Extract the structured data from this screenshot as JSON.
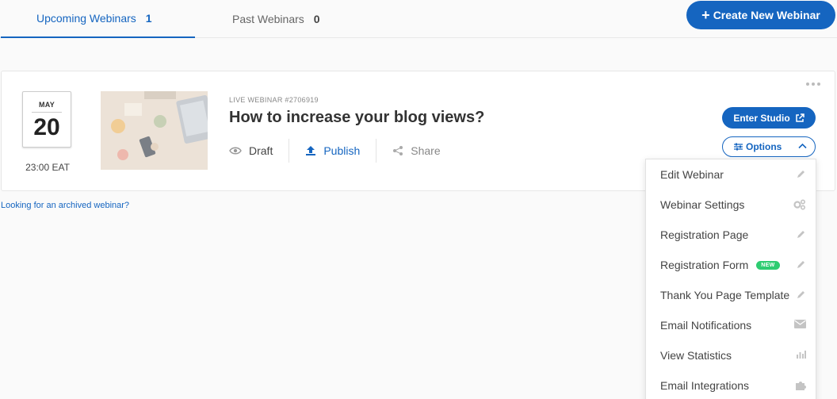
{
  "tabs": [
    {
      "label": "Upcoming Webinars",
      "count": "1"
    },
    {
      "label": "Past Webinars",
      "count": "0"
    }
  ],
  "header": {
    "create_label": "Create New Webinar",
    "create_icon": "plus-icon"
  },
  "webinar": {
    "month": "MAY",
    "day": "20",
    "time": "23:00 EAT",
    "id_label": "LIVE WEBINAR #2706919",
    "title": "How to increase your blog views?",
    "actions": {
      "draft": "Draft",
      "publish": "Publish",
      "share": "Share"
    },
    "enter_studio": "Enter Studio",
    "options": "Options"
  },
  "archived_link": "Looking for an archived webinar?",
  "options_menu": [
    {
      "label": "Edit Webinar",
      "icon": "pencil-icon"
    },
    {
      "label": "Webinar Settings",
      "icon": "gears-icon"
    },
    {
      "label": "Registration Page",
      "icon": "pencil-icon"
    },
    {
      "label": "Registration Form",
      "icon": "pencil-icon",
      "badge": "NEW"
    },
    {
      "label": "Thank You Page Template",
      "icon": "pencil-icon"
    },
    {
      "label": "Email Notifications",
      "icon": "envelope-icon"
    },
    {
      "label": "View Statistics",
      "icon": "bar-chart-icon"
    },
    {
      "label": "Email Integrations",
      "icon": "puzzle-icon"
    }
  ],
  "colors": {
    "accent": "#1565c0",
    "badge_new": "#2ecc71",
    "muted_icon": "#c4c4c4"
  }
}
